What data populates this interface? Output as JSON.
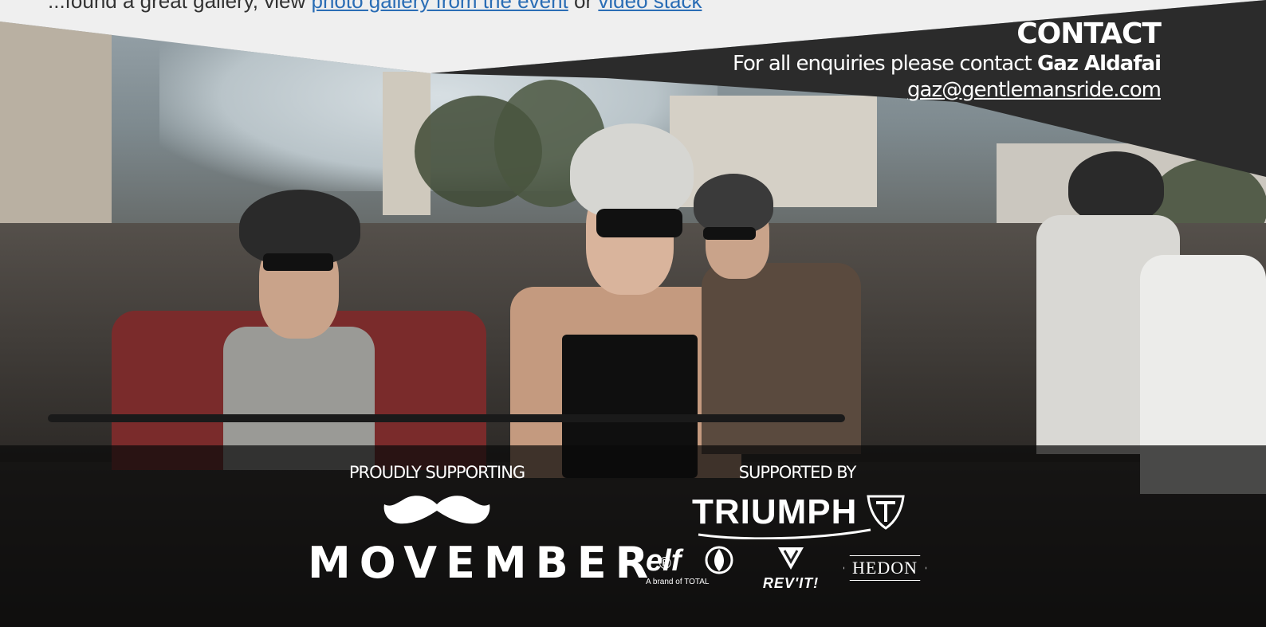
{
  "top_text": {
    "prefix": "...found a great gallery, view",
    "link1": "photo gallery from the event",
    "sep": "or",
    "link2": "video stack"
  },
  "contact": {
    "heading": "CONTACT",
    "intro": "For all enquiries please contact",
    "name": "Gaz Aldafai",
    "email": "gaz@gentlemansride.com"
  },
  "sponsors": {
    "proudly_supporting_label": "PROUDLY SUPPORTING",
    "movember": "MOVEMBER",
    "movember_reg": "®",
    "supported_by_label": "SUPPORTED BY",
    "triumph": "TRIUMPH",
    "elf": "elf",
    "elf_sub": "A brand of TOTAL",
    "revit": "REV'IT!",
    "hedon": "HEDON"
  },
  "colors": {
    "contact_band": "#2b2b2b",
    "link": "#2a6db5",
    "white": "#ffffff"
  },
  "icons": [
    "moustache-icon",
    "triumph-shield-icon",
    "elf-drop-icon",
    "revit-shield-icon"
  ]
}
